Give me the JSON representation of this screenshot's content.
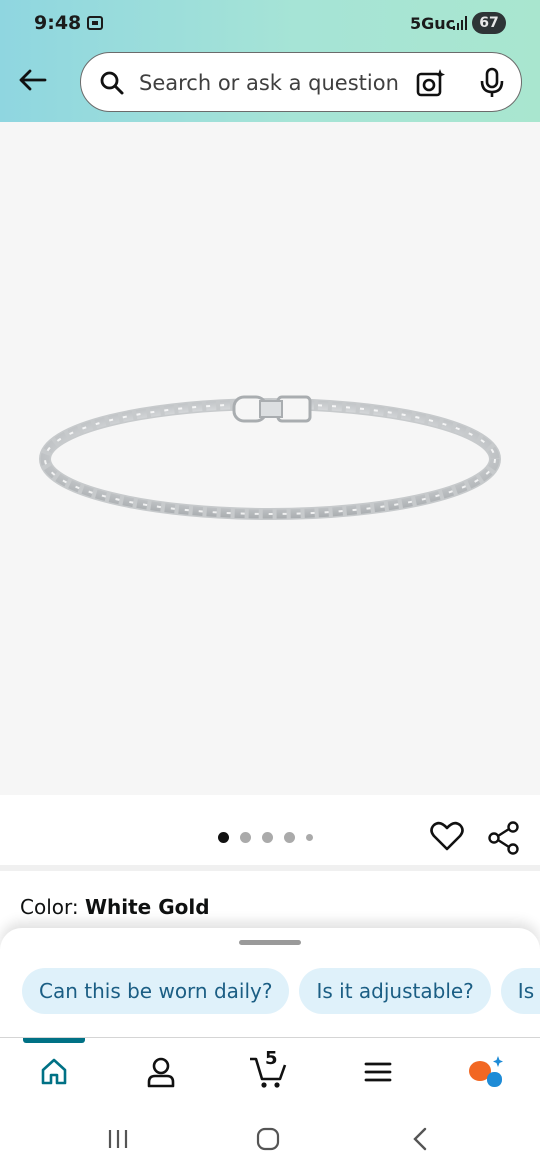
{
  "status_bar": {
    "time": "9:48",
    "network": "5Guc",
    "battery": "67",
    "icons": [
      "screenshot-icon",
      "signal-icon"
    ]
  },
  "header": {
    "back_icon": "back-arrow-icon",
    "search_placeholder": "Search or ask a question",
    "camera_icon": "camera-sparkle-icon",
    "mic_icon": "mic-icon"
  },
  "product": {
    "image_desc_icon": "tennis-bracelet-image",
    "carousel_dots": 5,
    "active_dot": 0,
    "color_label": "Color:",
    "color_value": "White Gold"
  },
  "sheet": {
    "suggestions": [
      "Can this be worn daily?",
      "Is it adjustable?",
      "Is it r"
    ]
  },
  "tabs": [
    {
      "name": "home",
      "icon": "home-icon",
      "active": true
    },
    {
      "name": "account",
      "icon": "person-icon"
    },
    {
      "name": "cart",
      "icon": "cart-icon",
      "count": "5"
    },
    {
      "name": "menu",
      "icon": "menu-icon"
    },
    {
      "name": "rufus",
      "icon": "rufus-icon"
    }
  ],
  "colors": {
    "accent": "#007185",
    "chip_bg": "#dff1fa",
    "chip_text": "#1b5e84",
    "rufus_orange": "#f26722",
    "rufus_blue": "#1e8bd6"
  }
}
